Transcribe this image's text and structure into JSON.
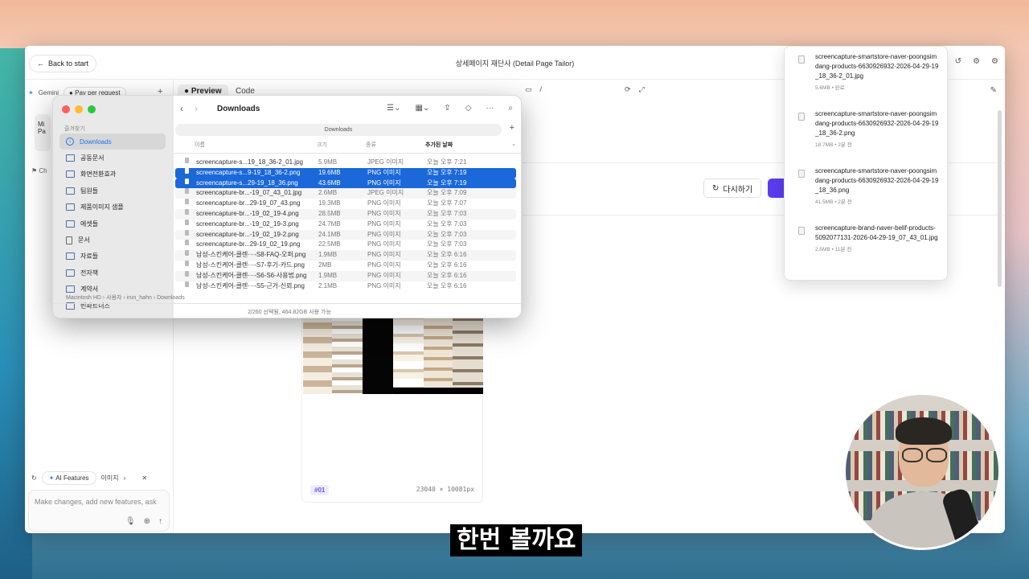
{
  "app": {
    "back_label": "Back to start",
    "title": "상세페이지 재단사 (Detail Page Tailor)"
  },
  "sidebar": {
    "model": "Gemini",
    "pricing": "Pay per request",
    "chat_card_lines": [
      "Mi",
      "Pa"
    ],
    "chat_hint": "Ch",
    "ai_features": "AI Features",
    "image_chip": "이미지",
    "prompt_placeholder": "Make changes, add new features, ask"
  },
  "main": {
    "tabs": [
      {
        "label": "Preview",
        "active": true
      },
      {
        "label": "Code",
        "active": false
      }
    ],
    "url": "/",
    "retry_label": "다시하기",
    "card": {
      "tag": "#01",
      "dims": "23040 × 10081px"
    }
  },
  "finder": {
    "title": "Downloads",
    "sidebar_heading": "즐겨찾기",
    "sidebar_items": [
      {
        "label": "Downloads",
        "icon": "download-icon",
        "active": true
      },
      {
        "label": "공동문서",
        "icon": "folder-icon"
      },
      {
        "label": "화면전환효과",
        "icon": "folder-icon"
      },
      {
        "label": "팀원들",
        "icon": "folder-icon"
      },
      {
        "label": "제품이미지 샘플",
        "icon": "folder-icon"
      },
      {
        "label": "에셋들",
        "icon": "folder-icon"
      },
      {
        "label": "문서",
        "icon": "document-icon"
      },
      {
        "label": "자료들",
        "icon": "folder-icon"
      },
      {
        "label": "전자책",
        "icon": "folder-icon"
      },
      {
        "label": "계약서",
        "icon": "folder-icon"
      },
      {
        "label": "빈파트너스",
        "icon": "folder-icon"
      }
    ],
    "path_label": "Downloads",
    "columns": {
      "name": "이름",
      "size": "크기",
      "kind": "종류",
      "date": "추가된 날짜"
    },
    "files": [
      {
        "name": "screencapture-s...19_18_36-2_01.jpg",
        "size": "5.9MB",
        "kind": "JPEG 이미지",
        "date": "오늘 오후 7:21",
        "selected": false
      },
      {
        "name": "screencapture-s...9-19_18_36-2.png",
        "size": "19.6MB",
        "kind": "PNG 이미지",
        "date": "오늘 오후 7:19",
        "selected": true
      },
      {
        "name": "screencapture-s...29-19_18_36.png",
        "size": "43.6MB",
        "kind": "PNG 이미지",
        "date": "오늘 오후 7:19",
        "selected": true
      },
      {
        "name": "screencapture-br...-19_07_43_01.jpg",
        "size": "2.6MB",
        "kind": "JPEG 이미지",
        "date": "오늘 오후 7:09",
        "selected": false
      },
      {
        "name": "screencapture-br...29-19_07_43.png",
        "size": "19.3MB",
        "kind": "PNG 이미지",
        "date": "오늘 오후 7:07",
        "selected": false
      },
      {
        "name": "screencapture-br...-19_02_19-4.png",
        "size": "28.5MB",
        "kind": "PNG 이미지",
        "date": "오늘 오후 7:03",
        "selected": false
      },
      {
        "name": "screencapture-br...-19_02_19-3.png",
        "size": "24.7MB",
        "kind": "PNG 이미지",
        "date": "오늘 오후 7:03",
        "selected": false
      },
      {
        "name": "screencapture-br...-19_02_19-2.png",
        "size": "24.1MB",
        "kind": "PNG 이미지",
        "date": "오늘 오후 7:03",
        "selected": false
      },
      {
        "name": "screencapture-br...29-19_02_19.png",
        "size": "22.5MB",
        "kind": "PNG 이미지",
        "date": "오늘 오후 7:03",
        "selected": false
      },
      {
        "name": "남성-스킨케어-클렌···-S8-FAQ-오퍼.png",
        "size": "1.9MB",
        "kind": "PNG 이미지",
        "date": "오늘 오후 6:16",
        "selected": false
      },
      {
        "name": "남성-스킨케어-클렌···-S7-후기-카드.png",
        "size": "2MB",
        "kind": "PNG 이미지",
        "date": "오늘 오후 6:16",
        "selected": false
      },
      {
        "name": "남성-스킨케어-클렌···-S6-S6-사용법.png",
        "size": "1.9MB",
        "kind": "PNG 이미지",
        "date": "오늘 오후 6:16",
        "selected": false
      },
      {
        "name": "남성-스킨케어-클렌···-S5-근거-신뢰.png",
        "size": "2.1MB",
        "kind": "PNG 이미지",
        "date": "오늘 오후 6:16",
        "selected": false
      }
    ],
    "breadcrumb": "Macintosh HD  ›  사용자  ›  irun_hahn  ›  Downloads",
    "status": "2/260 선택됨, 464.82GB 사용 가능"
  },
  "downloads_panel": {
    "items": [
      {
        "name": "screencapture-smartstore-naver-poongsimdang-products-6630926932-2026-04-29-19_18_36-2_01.jpg",
        "meta": "5.6MB • 완료"
      },
      {
        "name": "screencapture-smartstore-naver-poongsimdang-products-6630926932-2026-04-29-19_18_36-2.png",
        "meta": "18.7MB • 2분 전"
      },
      {
        "name": "screencapture-smartstore-naver-poongsimdang-products-6630926932-2026-04-29-19_18_36.png",
        "meta": "41.5MB • 2분 전"
      },
      {
        "name": "screencapture-brand-naver-belif-products-5092077131-2026-04-29-19_07_43_01.jpg",
        "meta": "2.5MB • 11분 전"
      },
      {
        "name": "screencapture-brand-naver-belif-",
        "meta": ""
      }
    ]
  },
  "subtitle": "한번 볼까요",
  "colors": {
    "accent": "#5b3cf0",
    "selection": "#1a68d9",
    "finder_link": "#1a73e8"
  }
}
